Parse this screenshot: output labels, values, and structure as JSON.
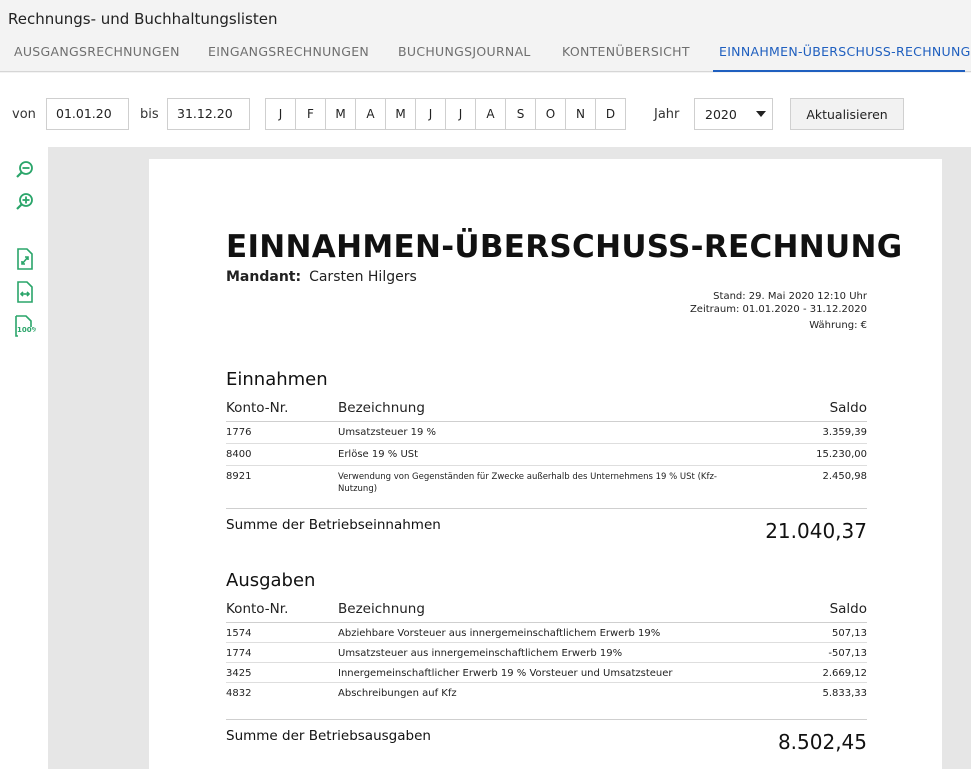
{
  "app": {
    "title": "Rechnungs- und Buchhaltungslisten"
  },
  "tabs": [
    {
      "label": "AUSGANGSRECHNUNGEN",
      "active": false
    },
    {
      "label": "EINGANGSRECHNUNGEN",
      "active": false
    },
    {
      "label": "BUCHUNGSJOURNAL",
      "active": false
    },
    {
      "label": "KONTENÜBERSICHT",
      "active": false
    },
    {
      "label": "EINNAHMEN-ÜBERSCHUSS-RECHNUNG",
      "active": true
    }
  ],
  "toolbar": {
    "from_label": "von",
    "from_value": "01.01.20",
    "to_label": "bis",
    "to_value": "31.12.20",
    "months": [
      "J",
      "F",
      "M",
      "A",
      "M",
      "J",
      "J",
      "A",
      "S",
      "O",
      "N",
      "D"
    ],
    "year_label": "Jahr",
    "year_value": "2020",
    "update_label": "Aktualisieren"
  },
  "sidebar": {
    "icons": [
      "zoom-out-icon",
      "zoom-in-icon",
      "fit-page-icon",
      "fit-width-icon",
      "actual-size-icon"
    ],
    "actual_size_text": "100%"
  },
  "document": {
    "title": "EINNAHMEN-ÜBERSCHUSS-RECHNUNG",
    "mandant_label": "Mandant:",
    "mandant_value": "Carsten Hilgers",
    "stand": "Stand:  29. Mai 2020 12:10 Uhr",
    "zeitraum": "Zeitraum: 01.01.2020 - 31.12.2020",
    "waehrung": "Währung: €",
    "income": {
      "title": "Einnahmen",
      "headers": [
        "Konto-Nr.",
        "Bezeichnung",
        "Saldo"
      ],
      "rows": [
        {
          "konto": "1776",
          "bezeichnung": "Umsatzsteuer 19 %",
          "saldo": "3.359,39"
        },
        {
          "konto": "8400",
          "bezeichnung": "Erlöse 19 % USt",
          "saldo": "15.230,00"
        },
        {
          "konto": "8921",
          "bezeichnung": "Verwendung von Gegenständen für Zwecke außerhalb des Unternehmens 19 % USt (Kfz-Nutzung)",
          "saldo": "2.450,98"
        }
      ],
      "sum_label": "Summe der Betriebseinnahmen",
      "sum_value": "21.040,37"
    },
    "expenses": {
      "title": "Ausgaben",
      "headers": [
        "Konto-Nr.",
        "Bezeichnung",
        "Saldo"
      ],
      "rows": [
        {
          "konto": "1574",
          "bezeichnung": "Abziehbare Vorsteuer aus innergemeinschaftlichem Erwerb 19%",
          "saldo": "507,13"
        },
        {
          "konto": "1774",
          "bezeichnung": "Umsatzsteuer aus innergemeinschaftlichem Erwerb 19%",
          "saldo": "-507,13"
        },
        {
          "konto": "3425",
          "bezeichnung": "Innergemeinschaftlicher Erwerb 19 % Vorsteuer und Umsatzsteuer",
          "saldo": "2.669,12"
        },
        {
          "konto": "4832",
          "bezeichnung": "Abschreibungen auf Kfz",
          "saldo": "5.833,33"
        }
      ],
      "sum_label": "Summe der Betriebsausgaben",
      "sum_value": "8.502,45"
    }
  },
  "colors": {
    "accent": "#1f5fbf",
    "icon_green": "#2aa56a"
  }
}
